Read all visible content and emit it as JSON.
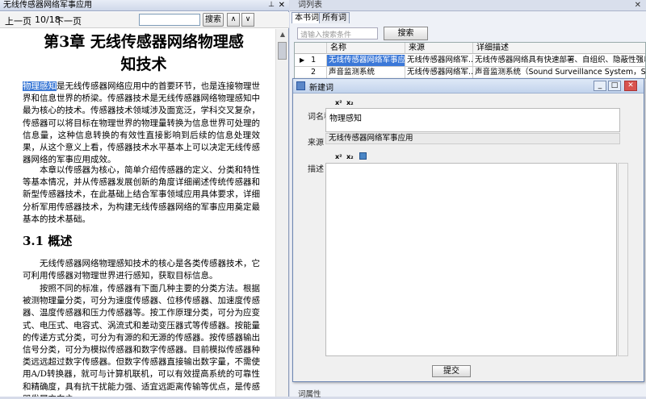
{
  "reader": {
    "title": "无线传感器网络军事应用",
    "pin": "⊥",
    "close": "✕",
    "prev": "上一页",
    "page": "10/18",
    "next": "下一页",
    "search_btn": "搜索",
    "up": "∧",
    "down": "∨",
    "chapter_title_l1": "第3章  无线传感器网络物理感",
    "chapter_title_l2": "知技术",
    "p1_hl": "物理感知",
    "p1_rest": "是无线传感器网络应用中的首要环节，也是连接物理世界和信息世界的桥梁。传感器技术是无线传感器网络物理感知中最为核心的技术。传感器技术领域涉及面宽泛，学科交叉复杂，传感器可以将目标在物理世界的物理量转换为信息世界可处理的信息量，这种信息转换的有效性直接影响到后续的信息处理效果，从这个意义上看，传感器技术水平基本上可以决定无线传感器网络的军事应用成效。",
    "p2": "本章以传感器为核心，简单介绍传感器的定义、分类和特性等基本情况，并从传感器发展创新的角度详细阐述传统传感器和新型传感器技术，在此基础上结合军事领域应用具体要求，详细分析军用传感器技术，为构建无线传感器网络的军事应用奠定最基本的技术基础。",
    "section": "3.1  概述",
    "p3": "无线传感器网络物理感知技术的核心是各类传感器技术，它可利用传感器对物理世界进行感知，获取目标信息。",
    "p4": "按照不同的标准，传感器有下面几种主要的分类方法。根据被测物理量分类，可分为速度传感器、位移传感器、加速度传感器、温度传感器和压力传感器等。按工作原理分类，可分为应变式、电压式、电容式、涡流式和差动变压器式等传感器。按能量的传递方式分类，可分为有源的和无源的传感器。按传感器输出信号分类，可分为模拟传感器和数字传感器。目前模拟传感器种类远远超过数字传感器。但数字传感器直接输出数字量，不需使用A/D转换器，就可与计算机联机，可以有效提高系统的可靠性和精确度，具有抗干扰能力强、适宜远距离传输等优点，是传感器发展方向之一。"
  },
  "right": {
    "title": "词列表",
    "close": "✕",
    "tabs": [
      "本书词",
      "所有词"
    ],
    "filter_placeholder": "请输入搜索条件",
    "search_btn": "搜索",
    "columns": [
      "名称",
      "来源",
      "详细描述"
    ],
    "rows": [
      {
        "num": "1",
        "name": "无线传感器网络军事应用",
        "source": "无线传感器网络军...",
        "desc": "无线传感器网络具有快速部署、自组织、隐蔽性强以..."
      },
      {
        "num": "2",
        "name": "声音监测系统",
        "source": "无线传感器网络军...",
        "desc": "声音监测系统（Sound Surveillance System，SOSUS..."
      }
    ],
    "bottom_tab": "词属性"
  },
  "dialog": {
    "title": "新建词",
    "name_label": "词名称",
    "name_value": "物理感知",
    "source_label": "来源",
    "source_value": "无线传感器网络军事应用",
    "desc_label": "描述",
    "sup": "x²",
    "sub": "x₂",
    "submit": "提交",
    "min": "_",
    "max": "□",
    "close": "✕"
  }
}
